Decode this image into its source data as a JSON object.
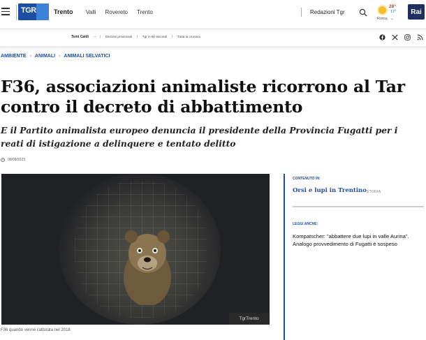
{
  "header": {
    "logo_text": "TGR",
    "region": "Trento",
    "nav": [
      "Valli",
      "Rovereto",
      "Trento"
    ],
    "redazioni": "Redazioni Tgr",
    "weather": {
      "temp_max": "28°",
      "temp_min": "17°",
      "city": "Roma"
    },
    "brand": "Rai"
  },
  "hot_topics": {
    "label": "Temi Caldi",
    "links": [
      "Elezioni provinciali",
      "Tgr in 60 secondi",
      "Tutta la cronaca"
    ]
  },
  "breadcrumb": [
    "AMBIENTE",
    "ANIMALI",
    "ANIMALI SELVATICI"
  ],
  "article": {
    "title": "F36, associazioni animaliste ricorrono al Tar contro il decreto di abbattimento",
    "subtitle": "E il Partito animalista europeo denuncia il presidente della Provincia Fugatti per i reati di istigazione a delinquere e tentato delitto",
    "date": "09/09/2023",
    "photo_badge": "TgrTrento",
    "photo_caption": "F36 quando venne catturata nel 2018"
  },
  "sidebar": {
    "content_in_label": "CONTENUTO IN:",
    "content_in_link": "Orsi e lupi in Trentino",
    "content_in_tag": "STORIA",
    "read_also_label": "LEGGI ANCHE:",
    "read_also_text": "Kompatscher: \"abbattere due lupi in valle Aurina\". Analogo provvedimento di Fugatti è sospeso"
  },
  "colors": {
    "accent": "#1d4fa0",
    "brand_dark": "#1f2f5f",
    "weather_sun": "#f4c02a"
  }
}
